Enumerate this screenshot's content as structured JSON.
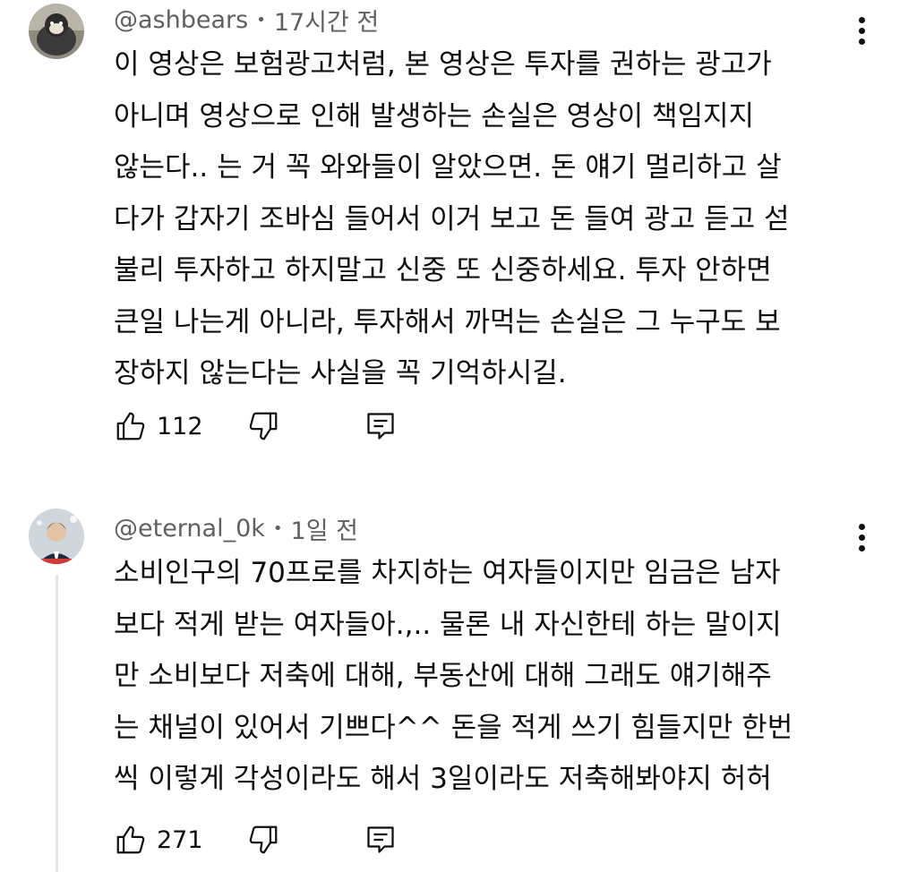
{
  "comments": [
    {
      "author": "@ashbears",
      "separator": "•",
      "time": "17시간 전",
      "lines": [
        "이 영상은 보험광고처럼, 본 영상은 투자를 권하는 광고가",
        "아니며 영상으로 인해 발생하는 손실은 영상이 책임지지",
        "않는다.. 는 거 꼭 와와들이 알았으면. 돈 얘기 멀리하고 살",
        "다가 갑자기 조바심 들어서 이거 보고 돈 들여 광고 듣고 섣",
        "불리 투자하고 하지말고 신중 또 신중하세요. 투자 안하면",
        "큰일 나는게 아니라, 투자해서 까먹는 손실은 그 누구도 보",
        "장하지 않는다는 사실을 꼭 기억하시길."
      ],
      "likes": "112",
      "icons": {
        "like": "thumb-up-icon",
        "dislike": "thumb-down-icon",
        "reply": "reply-icon",
        "more": "more-vert-icon"
      }
    },
    {
      "author": "@eternal_0k",
      "separator": "•",
      "time": "1일 전",
      "lines": [
        "소비인구의 70프로를 차지하는 여자들이지만 임금은 남자",
        "보다 적게 받는 여자들아.,.. 물론 내 자신한테 하는 말이지",
        "만 소비보다 저축에 대해, 부동산에 대해 그래도 얘기해주",
        "는 채널이 있어서 기쁘다^^ 돈을 적게 쓰기 힘들지만 한번",
        "씩 이렇게 각성이라도 해서 3일이라도 저축해봐야지 허허"
      ],
      "likes": "271",
      "icons": {
        "like": "thumb-up-icon",
        "dislike": "thumb-down-icon",
        "reply": "reply-icon",
        "more": "more-vert-icon"
      }
    }
  ],
  "colors": {
    "text": "#0f0f0f",
    "meta": "#606060",
    "thread_line": "#e5e5e5"
  }
}
